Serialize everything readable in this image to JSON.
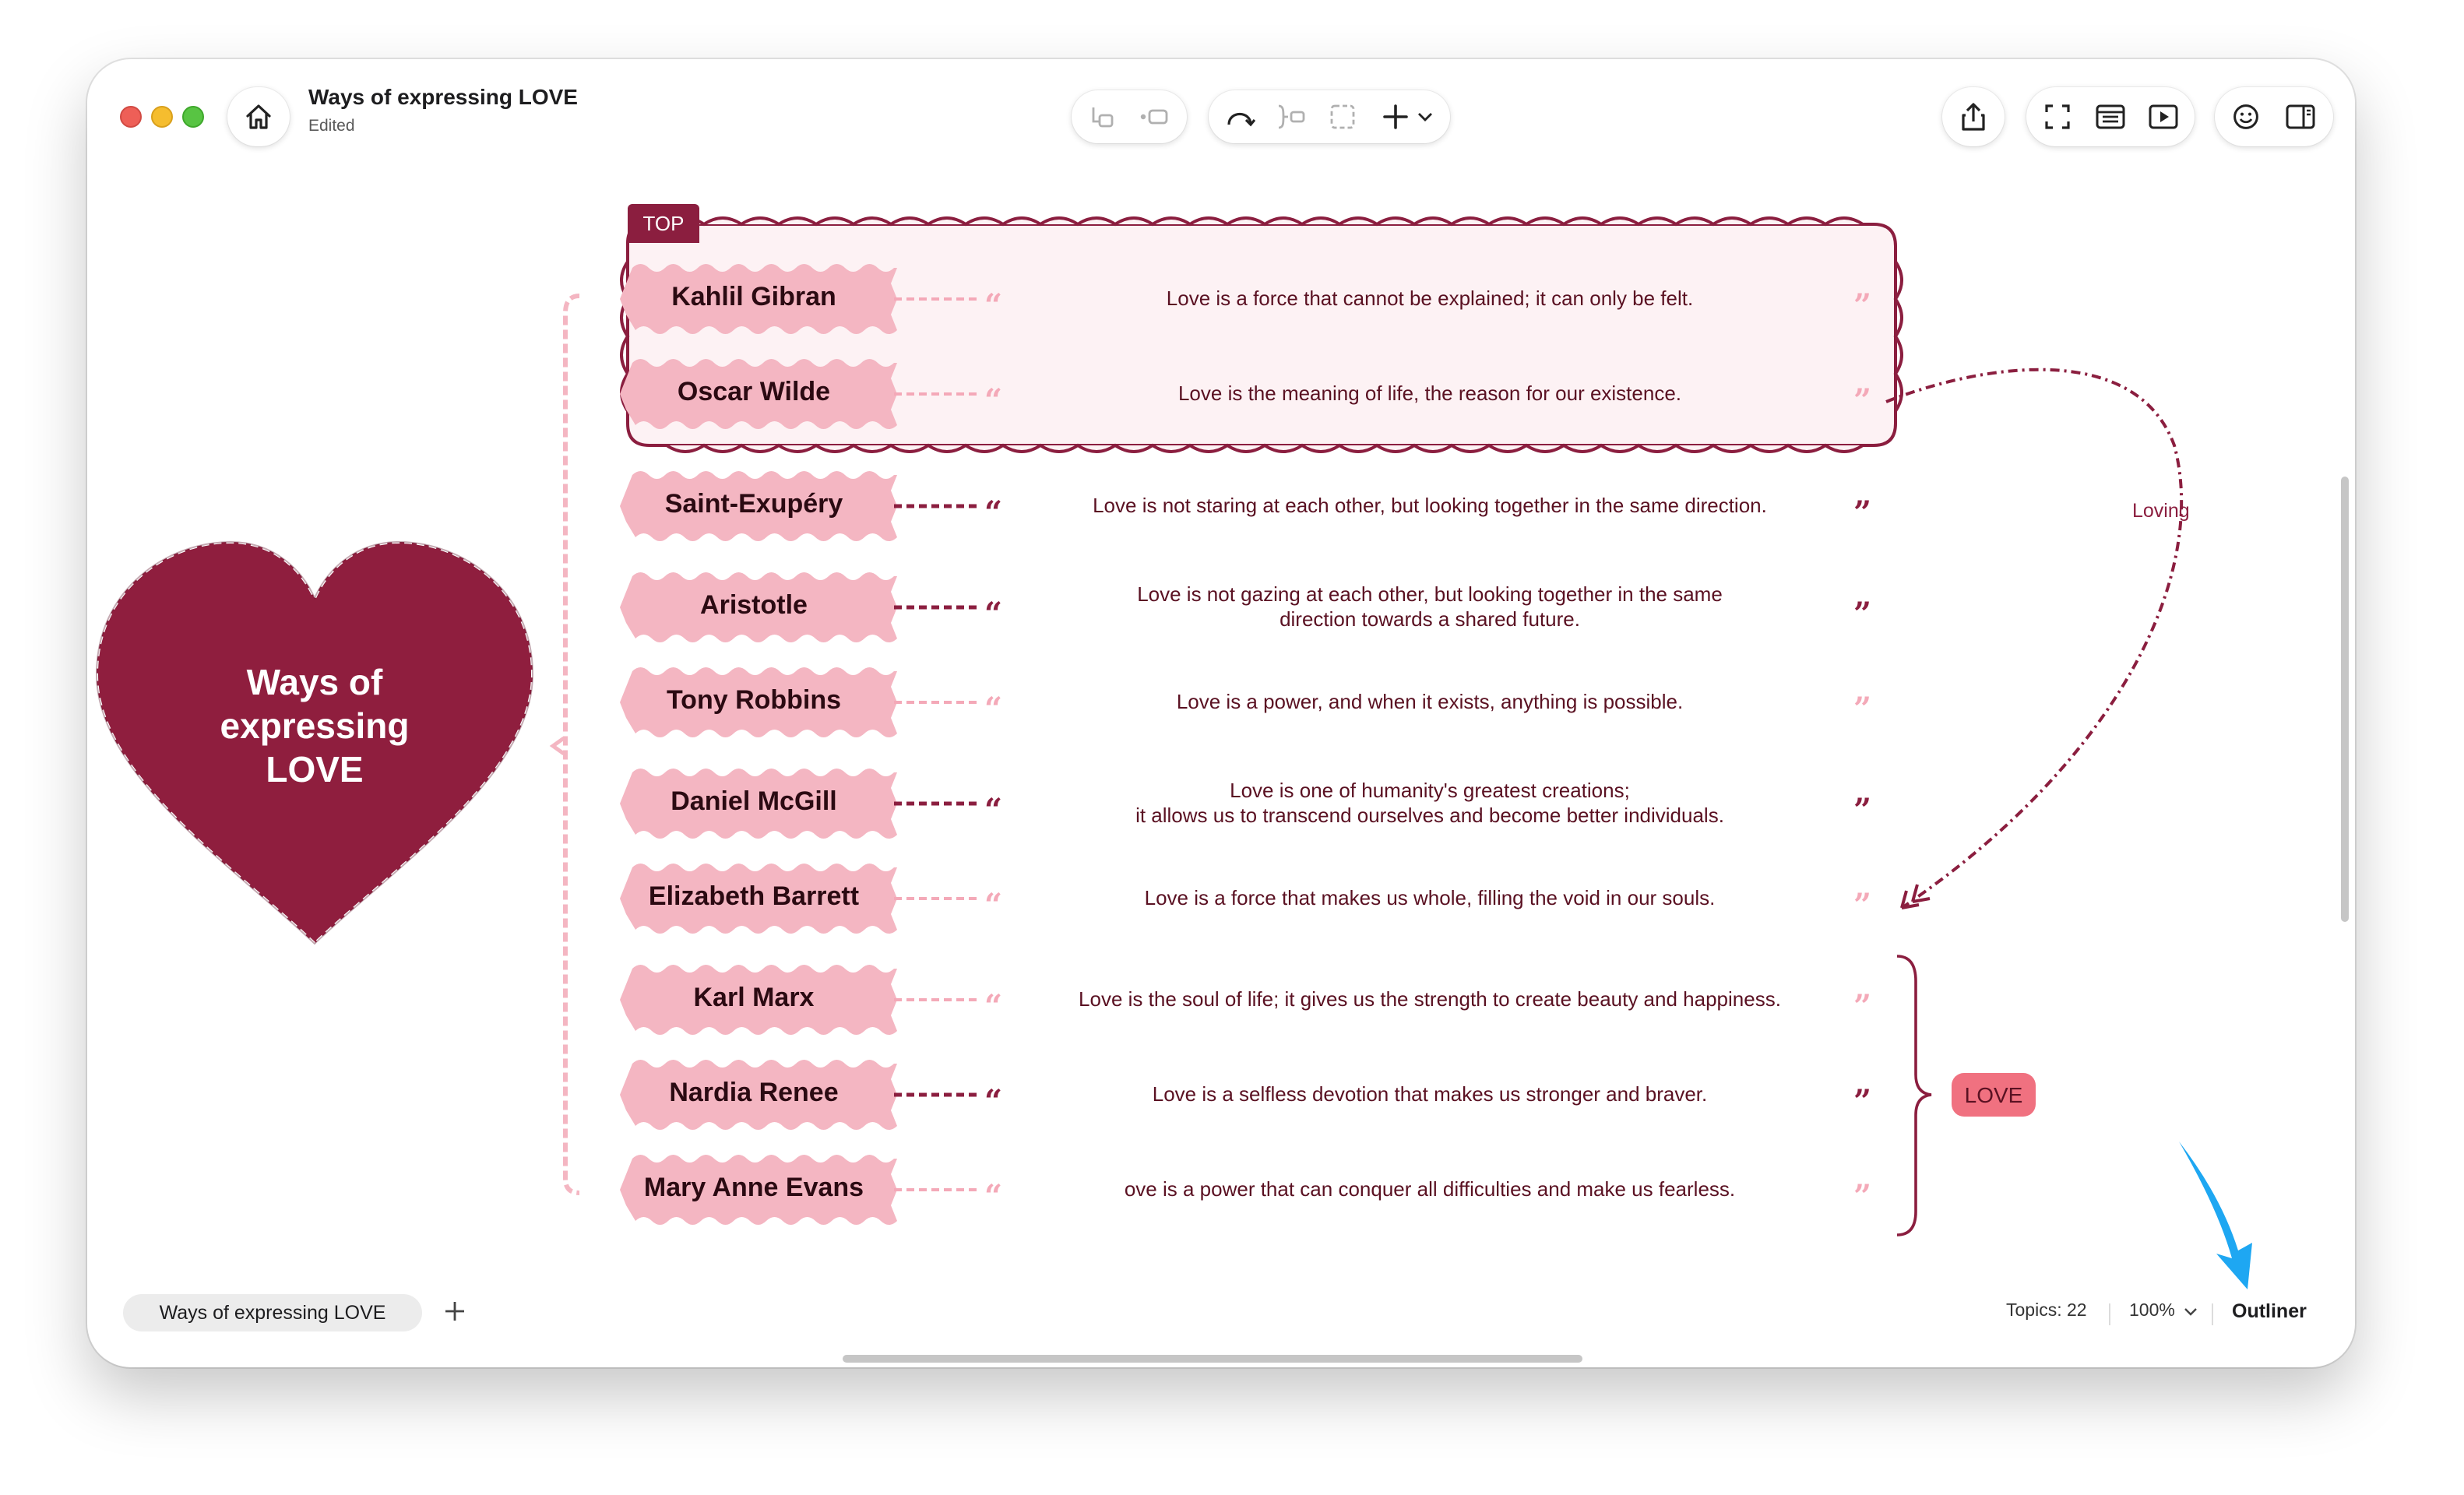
{
  "window": {
    "title": "Ways of expressing LOVE",
    "subtitle": "Edited"
  },
  "toolbar": {
    "home_icon": "home-icon",
    "left_group": [
      "subtopic-icon",
      "float-topic-icon"
    ],
    "center_group": [
      "relationship-icon",
      "summary-icon",
      "boundary-icon",
      "insert-plus-icon",
      "chevron-down-icon"
    ],
    "right_group_1": [
      "share-icon"
    ],
    "right_group_2": [
      "focus-fullscreen-icon",
      "format-panel-icon",
      "pitch-play-icon"
    ],
    "right_group_3": [
      "emoji-sticker-icon",
      "sidebar-toggle-icon"
    ]
  },
  "map": {
    "central_topic": "Ways of\nexpressing\nLOVE",
    "top_tag": "TOP",
    "relationship_label": "Loving",
    "summary_label": "LOVE",
    "open_quote": "“",
    "close_quote": "”",
    "topics": [
      {
        "name": "Kahlil Gibran",
        "quote": "Love is a force that cannot be explained; it can only be felt.",
        "style": "light"
      },
      {
        "name": "Oscar Wilde",
        "quote": "Love is the meaning of life, the reason for our existence.",
        "style": "light"
      },
      {
        "name": "Saint-Exupéry",
        "quote": "Love is not staring at each other, but looking together in the same direction.",
        "style": "dark"
      },
      {
        "name": "Aristotle",
        "quote": "Love is not gazing at each other, but looking together in the same\ndirection towards a shared future.",
        "style": "dark"
      },
      {
        "name": "Tony Robbins",
        "quote": "Love is a power, and when it exists, anything is possible.",
        "style": "light"
      },
      {
        "name": "Daniel McGill",
        "quote": "Love is one of humanity's greatest creations;\nit allows us to transcend ourselves and become better individuals.",
        "style": "dark"
      },
      {
        "name": "Elizabeth Barrett",
        "quote": "Love is a force that makes us whole, filling the void in our souls.",
        "style": "light"
      },
      {
        "name": "Karl Marx",
        "quote": "Love is the soul of life; it gives us the strength to create beauty and happiness.",
        "style": "light"
      },
      {
        "name": "Nardia Renee",
        "quote": "Love is a selfless devotion that makes us stronger and braver.",
        "style": "dark"
      },
      {
        "name": "Mary Anne Evans",
        "quote": "ove is a power that can conquer all difficulties and make us fearless.",
        "style": "light"
      }
    ]
  },
  "colors": {
    "accent": "#8b1e3f",
    "topic_fill": "#f4b6c2",
    "boundary_fill": "#fdf2f4",
    "light_connector": "#f4a9b8",
    "dark_connector": "#8b1e3f",
    "annotation_arrow": "#1ea7f2"
  },
  "statusbar": {
    "sheet_tab": "Ways of expressing LOVE",
    "add_sheet_icon": "plus-icon",
    "topics_count": "Topics: 22",
    "zoom": "100%",
    "outliner": "Outliner"
  }
}
